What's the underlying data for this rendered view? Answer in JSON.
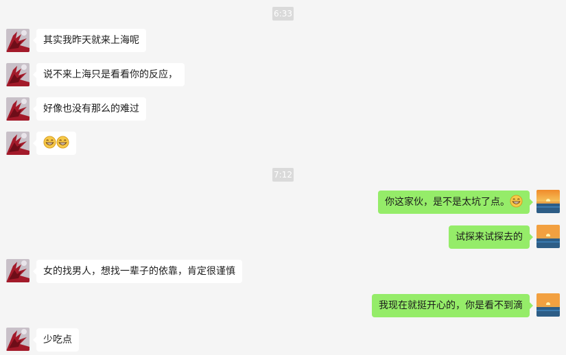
{
  "timestamps": [
    "6:33",
    "7:12"
  ],
  "messages": [
    {
      "side": "left",
      "text": "其实我昨天就来上海呢"
    },
    {
      "side": "left",
      "text": "说不来上海只是看看你的反应，"
    },
    {
      "side": "left",
      "text": "好像也没有那么的难过"
    },
    {
      "side": "left",
      "text": "",
      "emoji": [
        "grin-emoji",
        "grin-emoji"
      ]
    },
    {
      "side": "right",
      "text": "你这家伙，是不是太坑了点。",
      "emoji": [
        "grin-emoji"
      ]
    },
    {
      "side": "right",
      "text": "试探来试探去的"
    },
    {
      "side": "left",
      "text": "女的找男人，想找一辈子的依靠，肯定很谨慎"
    },
    {
      "side": "right",
      "text": "我现在就挺开心的，你是看不到滴"
    },
    {
      "side": "left",
      "text": "少吃点"
    }
  ],
  "colors": {
    "background": "#f5f5f5",
    "incoming_bubble": "#ffffff",
    "outgoing_bubble": "#95ec69",
    "timestamp_bg": "#dadada"
  },
  "icons": {
    "contact_avatar": "red-flower-avatar",
    "self_avatar": "sunset-sea-avatar",
    "emoji": "grin-emoji"
  }
}
